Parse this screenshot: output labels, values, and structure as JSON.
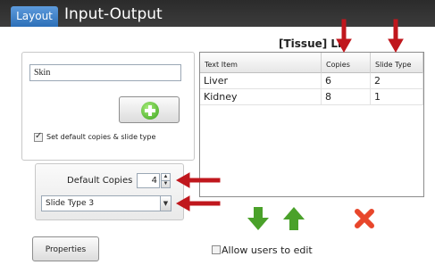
{
  "header": {
    "tab_label": "Layout",
    "title": "Input-Output"
  },
  "left": {
    "tissue_name_value": "Skin",
    "set_default_label": "Set default copies & slide type",
    "set_default_checked": true,
    "default_copies_label": "Default Copies",
    "default_copies_value": "4",
    "slide_type_value": "Slide Type 3",
    "properties_label": "Properties"
  },
  "list": {
    "title": "[Tissue] Lis",
    "columns": [
      "Text Item",
      "Copies",
      "Slide Type"
    ],
    "rows": [
      {
        "item": "Liver",
        "copies": "6",
        "slide_type": "2"
      },
      {
        "item": "Kidney",
        "copies": "8",
        "slide_type": "1"
      }
    ]
  },
  "actions": {
    "allow_edit_label": "Allow users to edit",
    "allow_edit_checked": false
  },
  "colors": {
    "accent_blue": "#2d6fb8",
    "annotation_red": "#c0171d",
    "move_green": "#4aa12a",
    "delete_red": "#e8462b"
  },
  "icons": {
    "add": "plus-circle-icon",
    "move_down": "arrow-down-icon",
    "move_up": "arrow-up-icon",
    "delete": "x-icon"
  }
}
